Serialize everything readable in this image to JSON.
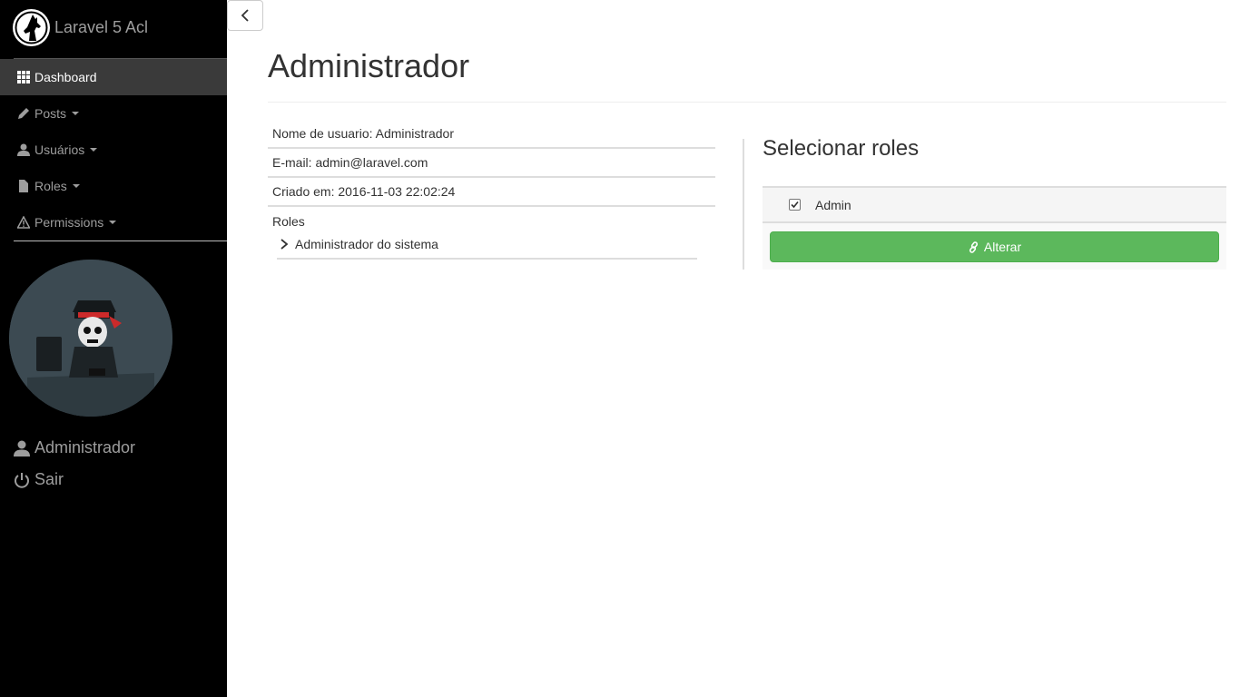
{
  "brand": {
    "title": "Laravel 5 Acl",
    "logo_icon": "wolf-logo-icon"
  },
  "sidebar": {
    "items": [
      {
        "label": "Dashboard",
        "icon": "grid-icon",
        "active": true,
        "dropdown": false
      },
      {
        "label": "Posts",
        "icon": "pencil-icon",
        "active": false,
        "dropdown": true
      },
      {
        "label": "Usuários",
        "icon": "user-icon",
        "active": false,
        "dropdown": true
      },
      {
        "label": "Roles",
        "icon": "file-icon",
        "active": false,
        "dropdown": true
      },
      {
        "label": "Permissions",
        "icon": "warning-icon",
        "active": false,
        "dropdown": true
      }
    ],
    "user_name": "Administrador",
    "logout_label": "Sair"
  },
  "main": {
    "title": "Administrador",
    "info": {
      "username": "Nome de usuario: Administrador",
      "email": "E-mail: admin@laravel.com",
      "created": "Criado em: 2016-11-03 22:02:24",
      "roles_label": "Roles",
      "roles": [
        "Administrador do sistema"
      ]
    },
    "roles_panel": {
      "title": "Selecionar roles",
      "options": [
        {
          "name": "Admin",
          "checked": true
        }
      ],
      "submit_label": "Alterar"
    }
  },
  "colors": {
    "sidebar_bg": "#000000",
    "active_item": "#3a3a3a",
    "success": "#5cb85c",
    "avatar_bg": "#3c4a52"
  }
}
